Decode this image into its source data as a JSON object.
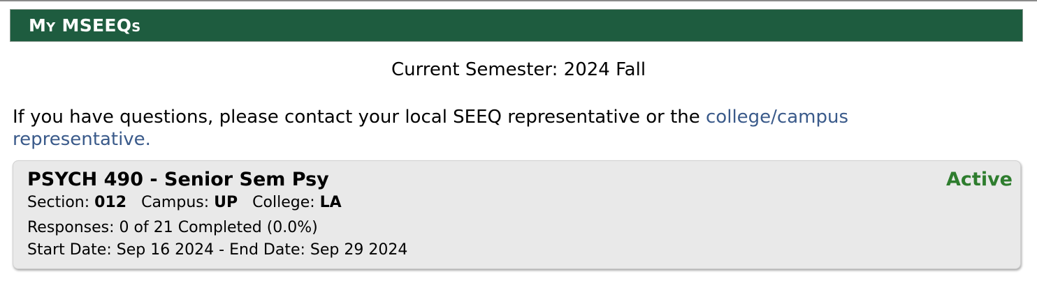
{
  "header": {
    "title": "My MSEEQs"
  },
  "semester": {
    "label": "Current Semester:",
    "value": "2024 Fall"
  },
  "contact": {
    "text": "If you have questions, please contact your local SEEQ representative or the",
    "link_text": "college/campus representative."
  },
  "courses": [
    {
      "title": "PSYCH 490 - Senior Sem Psy",
      "status": "Active",
      "section_label": "Section:",
      "section": "012",
      "campus_label": "Campus:",
      "campus": "UP",
      "college_label": "College:",
      "college": "LA",
      "responses_label": "Responses:",
      "responses_completed": 0,
      "responses_total": 21,
      "responses_text": "0 of 21 Completed (0.0%)",
      "start_label": "Start Date:",
      "start_date": "Sep 16 2024",
      "end_label": "End Date:",
      "end_date": "Sep 29 2024"
    }
  ],
  "colors": {
    "header_bg": "#1e5c3f",
    "link": "#3a5a8a",
    "status_active": "#2e7d2e",
    "card_bg": "#e9e9e9"
  }
}
